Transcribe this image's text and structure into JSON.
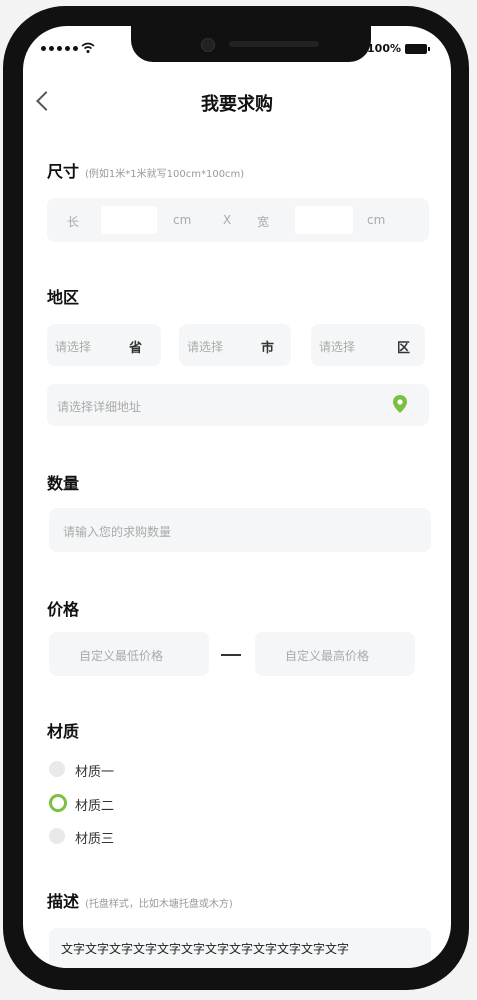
{
  "status": {
    "battery": "100%"
  },
  "header": {
    "title": "我要求购"
  },
  "size": {
    "label": "尺寸",
    "hint": "(例如1米*1米就写100cm*100cm)",
    "length_label": "长",
    "width_label": "宽",
    "unit": "cm",
    "times": "X"
  },
  "region": {
    "label": "地区",
    "placeholder": "请选择",
    "province": "省",
    "city": "市",
    "district": "区",
    "detail_placeholder": "请选择详细地址"
  },
  "quantity": {
    "label": "数量",
    "placeholder": "请输入您的求购数量"
  },
  "price": {
    "label": "价格",
    "min_placeholder": "自定义最低价格",
    "max_placeholder": "自定义最高价格"
  },
  "material": {
    "label": "材质",
    "options": [
      {
        "label": "材质一",
        "selected": false
      },
      {
        "label": "材质二",
        "selected": true
      },
      {
        "label": "材质三",
        "selected": false
      }
    ]
  },
  "description": {
    "label": "描述",
    "hint": "(托盘样式，比如木塘托盘或木方)",
    "text": "文字文字文字文字文字文字文字文字文字文字文字文字"
  },
  "colors": {
    "accent": "#7ac142"
  }
}
